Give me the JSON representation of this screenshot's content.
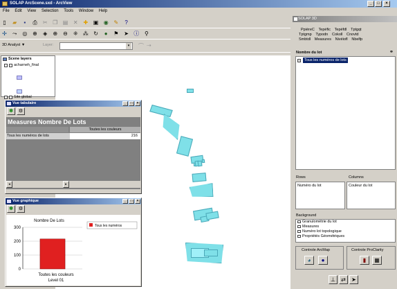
{
  "app": {
    "title": "SOLAP ArcScene.sxd - ArcView"
  },
  "menu": [
    "File",
    "Edit",
    "View",
    "Selection",
    "Tools",
    "Window",
    "Help"
  ],
  "toolbar": {
    "analyst": "3D Analyst ▼",
    "layer": "Layer:"
  },
  "layers": {
    "header": "Scene layers",
    "items": [
      "acharneh_final",
      "Site global"
    ]
  },
  "vue_tabulaire": {
    "title": "Vue tabulaire",
    "heading": "Measures Nombre De Lots",
    "col_header": "Toutes les couleurs",
    "row_label": "Tous les numéros de lots",
    "row_value": "216"
  },
  "vue_graphique": {
    "title": "Vue graphique",
    "chart_title": "Nombre De Lots",
    "legend": "Tous les numéros",
    "xlabel1": "Toutes les couleurs",
    "xlabel2": "Level 01"
  },
  "chart_data": {
    "type": "bar",
    "categories": [
      "Toutes les couleurs"
    ],
    "series": [
      {
        "name": "Tous les numéros",
        "values": [
          216
        ]
      }
    ],
    "title": "Nombre De Lots",
    "xlabel": "Level 01",
    "ylim": [
      0,
      300
    ],
    "yticks": [
      "300",
      "200",
      "100",
      "0"
    ],
    "color": "#e02020"
  },
  "solap": {
    "title": "SOLAP 3D",
    "tabs_row1": [
      "PpiéreC",
      "Tepéfic",
      "Tepéfdl",
      "Tptgqt"
    ],
    "tabs_row2": [
      "Tptgmp",
      "Typodn",
      "Cokoll",
      "Cnovtd"
    ],
    "tabs_row3": [
      "Smbtdl",
      "Measures",
      "Nivéiofl",
      "Nbelfp"
    ],
    "section": "Nombre du lot",
    "tree_item": "Tous les numéros de lots",
    "rows_label": "Rows",
    "columns_label": "Columns",
    "rows_value": "Numéro du lot",
    "columns_value": "Couleur du lot",
    "background_label": "Background",
    "background_items": [
      "Granulométrie du lot",
      "Measures",
      "Numéro lot topologique",
      "Propriétés Géométriques"
    ],
    "controle_arcmap": "Controle ArcMap",
    "controle_proclarity": "Controle ProClarity"
  }
}
